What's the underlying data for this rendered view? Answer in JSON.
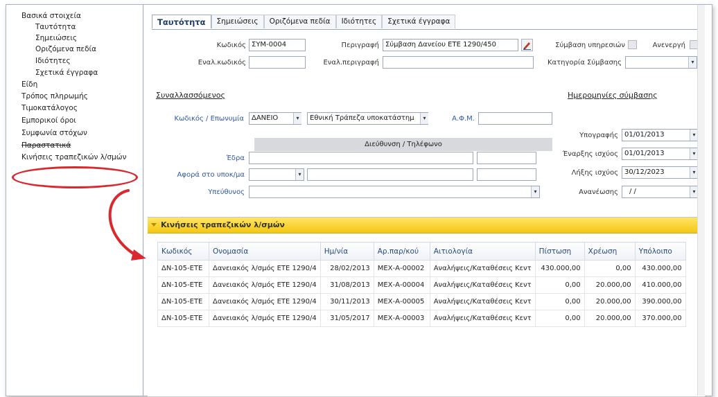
{
  "nav": {
    "items": [
      {
        "label": "Βασικά στοιχεία",
        "level": "top"
      },
      {
        "label": "Ταυτότητα",
        "level": "sub"
      },
      {
        "label": "Σημειώσεις",
        "level": "sub"
      },
      {
        "label": "Οριζόμενα πεδία",
        "level": "sub"
      },
      {
        "label": "Ιδιότητες",
        "level": "sub"
      },
      {
        "label": "Σχετικά έγγραφα",
        "level": "sub"
      },
      {
        "label": "Είδη",
        "level": "top"
      },
      {
        "label": "Τρόπος πληρωμής",
        "level": "top"
      },
      {
        "label": "Τιμοκατάλογος",
        "level": "top"
      },
      {
        "label": "Εμπορικοί όροι",
        "level": "top"
      },
      {
        "label": "Συμφωνία στόχων",
        "level": "top"
      },
      {
        "label": "Παραστατικά",
        "level": "top"
      },
      {
        "label": "Κινήσεις τραπεζικών λ/σμών",
        "level": "top"
      }
    ]
  },
  "tabs": [
    "Ταυτότητα",
    "Σημειώσεις",
    "Οριζόμενα πεδία",
    "Ιδιότητες",
    "Σχετικά έγγραφα"
  ],
  "form": {
    "code_label": "Κωδικός",
    "code_value": "ΣΥΜ-0004",
    "alt_code_label": "Εναλ.κωδικός",
    "desc_label": "Περιγραφή",
    "desc_value": "Σύμβαση Δανείου ΕΤΕ 1290/450",
    "alt_desc_label": "Εναλ.περιγραφή",
    "service_contract_label": "Σύμβαση υπηρεσιών",
    "inactive_label": "Ανενεργή",
    "category_label": "Κατηγορία Σύμβασης",
    "counterparty_section": "Συναλλασσόμενος",
    "dates_section": "Ημερομηνίες σύμβασης",
    "code_name_label": "Κωδικός / Επωνυμία",
    "counterparty_code": "ΔΑΝΕΙΟ",
    "counterparty_name": "Εθνική Τράπεζα υποκατάστημ",
    "afm_label": "Α.Φ.Μ.",
    "address_header": "Διεύθυνση / Τηλέφωνο",
    "seat_label": "Έδρα",
    "concerns_label": "Αφορά στο υποκ/μα",
    "responsible_label": "Υπεύθυνος",
    "sign_label": "Υπογραφής",
    "sign_value": "01/01/2013",
    "start_label": "Έναρξης ισχύος",
    "start_value": "01/01/2013",
    "end_label": "Λήξης ισχύος",
    "end_value": "30/12/2023",
    "renew_label": "Ανανέωσης",
    "renew_value": "/  /"
  },
  "grid": {
    "title": "Κινήσεις τραπεζικών λ/σμών",
    "columns": [
      "Κωδικός",
      "Ονομασία",
      "Ημ/νία",
      "Αρ.παρ/κού",
      "Αιτιολογία",
      "Πίστωση",
      "Χρέωση",
      "Υπόλοιπο"
    ],
    "rows": [
      [
        "ΔΝ-105-ΕΤΕ",
        "Δανειακός λ/σμός ΕΤΕ 1290/4",
        "28/02/2013",
        "ΜΕΧ-Α-00002",
        "Αναλήψεις/Καταθέσεις Κεντ",
        "430.000,00",
        "0,00",
        "430.000,00"
      ],
      [
        "ΔΝ-105-ΕΤΕ",
        "Δανειακός λ/σμός ΕΤΕ 1290/4",
        "31/08/2013",
        "ΜΕΧ-Α-00004",
        "Αναλήψεις/Καταθέσεις Κεντ",
        "0,00",
        "20.000,00",
        "410.000,00"
      ],
      [
        "ΔΝ-105-ΕΤΕ",
        "Δανειακός λ/σμός ΕΤΕ 1290/4",
        "30/11/2013",
        "ΜΕΧ-Α-00005",
        "Αναλήψεις/Καταθέσεις Κεντ",
        "0,00",
        "20.000,00",
        "390.000,00"
      ],
      [
        "ΔΝ-105-ΕΤΕ",
        "Δανειακός λ/σμός ΕΤΕ 1290/4",
        "31/05/2017",
        "ΜΕΧ-Α-00003",
        "Αναλήψεις/Καταθέσεις Κεντ",
        "0,00",
        "20.000,00",
        "370.000,00"
      ]
    ]
  },
  "colors": {
    "accent_blue": "#2f56a6",
    "grid_header_yellow": "#f4c712",
    "highlight_red": "#d9282e"
  }
}
